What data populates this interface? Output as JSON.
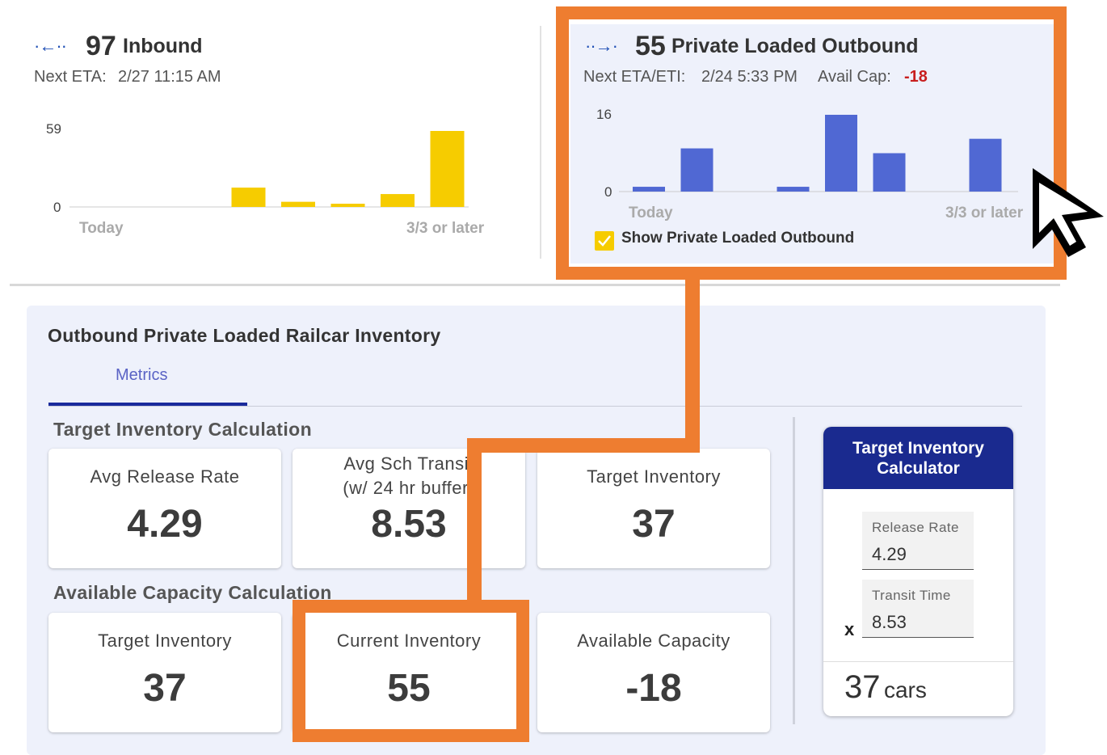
{
  "inbound": {
    "arrow": "·←··",
    "count": "97",
    "label": "Inbound",
    "next_eta_label": "Next ETA:",
    "next_eta_value": "2/27 11:15 AM",
    "chart_data": {
      "type": "bar",
      "color": "#f6cc00",
      "y_tick_top": "59",
      "y_tick_zero": "0",
      "x_first": "Today",
      "x_last": "3/3 or later",
      "ylim": [
        0,
        59
      ],
      "values": [
        0,
        0,
        0,
        15,
        4,
        2,
        10,
        59
      ]
    }
  },
  "outbound": {
    "arrow": "··→·",
    "count": "55",
    "label": "Private Loaded Outbound",
    "next_eta_label": "Next ETA/ETI:",
    "next_eta_value": "2/24 5:33 PM",
    "avail_cap_label": "Avail Cap:",
    "avail_cap_value": "-18",
    "checkbox_label": "Show Private Loaded Outbound",
    "checkbox_checked": true,
    "chart_data": {
      "type": "bar",
      "color": "#5068d3",
      "y_tick_top": "16",
      "y_tick_zero": "0",
      "x_first": "Today",
      "x_last": "3/3 or later",
      "ylim": [
        0,
        16
      ],
      "values": [
        1,
        9,
        0,
        1,
        16,
        8,
        0,
        11
      ]
    }
  },
  "panel": {
    "title": "Outbound Private Loaded Railcar Inventory",
    "tab": "Metrics",
    "section1": "Target Inventory Calculation",
    "section2": "Available Capacity Calculation",
    "cards1": [
      {
        "label": "Avg Release Rate",
        "value": "4.29"
      },
      {
        "label": "Avg Sch Transit",
        "label2": "(w/ 24 hr buffer)",
        "value": "8.53"
      },
      {
        "label": "Target Inventory",
        "value": "37"
      }
    ],
    "cards2": [
      {
        "label": "Target Inventory",
        "value": "37"
      },
      {
        "label": "Current Inventory",
        "value": "55"
      },
      {
        "label": "Available Capacity",
        "value": "-18"
      }
    ]
  },
  "calculator": {
    "title_line1": "Target Inventory",
    "title_line2": "Calculator",
    "release_label": "Release Rate",
    "release_value": "4.29",
    "x_symbol": "x",
    "transit_label": "Transit Time",
    "transit_value": "8.53",
    "result_number": "37",
    "result_unit": "cars"
  },
  "colors": {
    "highlight": "#ee7d30",
    "accent": "#1a2a8f",
    "negative": "#c81e1e"
  }
}
